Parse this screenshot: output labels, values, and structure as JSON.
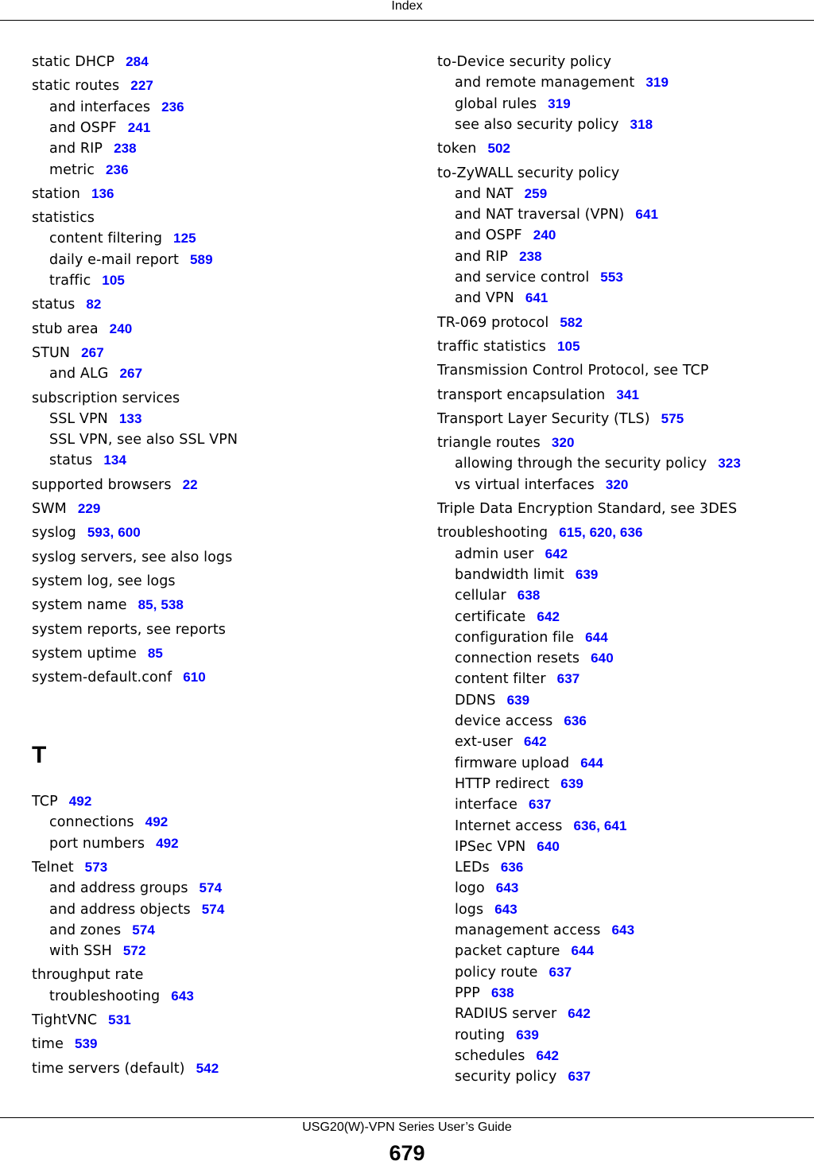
{
  "header": {
    "title": "Index"
  },
  "footer": {
    "guide_title": "USG20(W)-VPN Series User’s Guide",
    "page_number": "679"
  },
  "left_column": [
    {
      "term": "static DHCP",
      "pages": [
        "284"
      ],
      "level": 0
    },
    {
      "term": "static routes",
      "pages": [
        "227"
      ],
      "level": 0
    },
    {
      "term": "and interfaces",
      "pages": [
        "236"
      ],
      "level": 1
    },
    {
      "term": "and OSPF",
      "pages": [
        "241"
      ],
      "level": 1
    },
    {
      "term": "and RIP",
      "pages": [
        "238"
      ],
      "level": 1
    },
    {
      "term": "metric",
      "pages": [
        "236"
      ],
      "level": 1
    },
    {
      "term": "station",
      "pages": [
        "136"
      ],
      "level": 0
    },
    {
      "term": "statistics",
      "pages": [],
      "level": 0
    },
    {
      "term": "content filtering",
      "pages": [
        "125"
      ],
      "level": 1
    },
    {
      "term": "daily e-mail report",
      "pages": [
        "589"
      ],
      "level": 1
    },
    {
      "term": "traffic",
      "pages": [
        "105"
      ],
      "level": 1
    },
    {
      "term": "status",
      "pages": [
        "82"
      ],
      "level": 0
    },
    {
      "term": "stub area",
      "pages": [
        "240"
      ],
      "level": 0
    },
    {
      "term": "STUN",
      "pages": [
        "267"
      ],
      "level": 0
    },
    {
      "term": "and ALG",
      "pages": [
        "267"
      ],
      "level": 1
    },
    {
      "term": "subscription services",
      "pages": [],
      "level": 0
    },
    {
      "term": "SSL VPN",
      "pages": [
        "133"
      ],
      "level": 1
    },
    {
      "term": "SSL VPN, see also SSL VPN",
      "pages": [],
      "level": 1
    },
    {
      "term": "status",
      "pages": [
        "134"
      ],
      "level": 1
    },
    {
      "term": "supported browsers",
      "pages": [
        "22"
      ],
      "level": 0
    },
    {
      "term": "SWM",
      "pages": [
        "229"
      ],
      "level": 0
    },
    {
      "term": "syslog",
      "pages": [
        "593",
        "600"
      ],
      "level": 0
    },
    {
      "term": "syslog servers, see also logs",
      "pages": [],
      "level": 0
    },
    {
      "term": "system log, see logs",
      "pages": [],
      "level": 0
    },
    {
      "term": "system name",
      "pages": [
        "85",
        "538"
      ],
      "level": 0
    },
    {
      "term": "system reports, see reports",
      "pages": [],
      "level": 0
    },
    {
      "term": "system uptime",
      "pages": [
        "85"
      ],
      "level": 0
    },
    {
      "term": "system-default.conf",
      "pages": [
        "610"
      ],
      "level": 0
    }
  ],
  "section_letter": "T",
  "left_column_t": [
    {
      "term": "TCP",
      "pages": [
        "492"
      ],
      "level": 0
    },
    {
      "term": "connections",
      "pages": [
        "492"
      ],
      "level": 1
    },
    {
      "term": "port numbers",
      "pages": [
        "492"
      ],
      "level": 1
    },
    {
      "term": "Telnet",
      "pages": [
        "573"
      ],
      "level": 0
    },
    {
      "term": "and address groups",
      "pages": [
        "574"
      ],
      "level": 1
    },
    {
      "term": "and address objects",
      "pages": [
        "574"
      ],
      "level": 1
    },
    {
      "term": "and zones",
      "pages": [
        "574"
      ],
      "level": 1
    },
    {
      "term": "with SSH",
      "pages": [
        "572"
      ],
      "level": 1
    },
    {
      "term": "throughput rate",
      "pages": [],
      "level": 0
    },
    {
      "term": "troubleshooting",
      "pages": [
        "643"
      ],
      "level": 1
    },
    {
      "term": "TightVNC",
      "pages": [
        "531"
      ],
      "level": 0
    },
    {
      "term": "time",
      "pages": [
        "539"
      ],
      "level": 0
    },
    {
      "term": "time servers (default)",
      "pages": [
        "542"
      ],
      "level": 0
    }
  ],
  "right_column": [
    {
      "term": "to-Device security policy",
      "pages": [],
      "level": 0
    },
    {
      "term": "and remote management",
      "pages": [
        "319"
      ],
      "level": 1
    },
    {
      "term": "global rules",
      "pages": [
        "319"
      ],
      "level": 1
    },
    {
      "term": "see also security policy",
      "pages": [
        "318"
      ],
      "level": 1
    },
    {
      "term": "token",
      "pages": [
        "502"
      ],
      "level": 0
    },
    {
      "term": "to-ZyWALL security policy",
      "pages": [],
      "level": 0
    },
    {
      "term": "and NAT",
      "pages": [
        "259"
      ],
      "level": 1
    },
    {
      "term": "and NAT traversal (VPN)",
      "pages": [
        "641"
      ],
      "level": 1
    },
    {
      "term": "and OSPF",
      "pages": [
        "240"
      ],
      "level": 1
    },
    {
      "term": "and RIP",
      "pages": [
        "238"
      ],
      "level": 1
    },
    {
      "term": "and service control",
      "pages": [
        "553"
      ],
      "level": 1
    },
    {
      "term": "and VPN",
      "pages": [
        "641"
      ],
      "level": 1
    },
    {
      "term": "TR-069 protocol",
      "pages": [
        "582"
      ],
      "level": 0
    },
    {
      "term": "traffic statistics",
      "pages": [
        "105"
      ],
      "level": 0
    },
    {
      "term": "Transmission Control Protocol, see TCP",
      "pages": [],
      "level": 0
    },
    {
      "term": "transport encapsulation",
      "pages": [
        "341"
      ],
      "level": 0
    },
    {
      "term": "Transport Layer Security (TLS)",
      "pages": [
        "575"
      ],
      "level": 0
    },
    {
      "term": "triangle routes",
      "pages": [
        "320"
      ],
      "level": 0
    },
    {
      "term": "allowing through the security policy",
      "pages": [
        "323"
      ],
      "level": 1
    },
    {
      "term": "vs virtual interfaces",
      "pages": [
        "320"
      ],
      "level": 1
    },
    {
      "term": "Triple Data Encryption Standard, see 3DES",
      "pages": [],
      "level": 0
    },
    {
      "term": "troubleshooting",
      "pages": [
        "615",
        "620",
        "636"
      ],
      "level": 0
    },
    {
      "term": "admin user",
      "pages": [
        "642"
      ],
      "level": 1
    },
    {
      "term": "bandwidth limit",
      "pages": [
        "639"
      ],
      "level": 1
    },
    {
      "term": "cellular",
      "pages": [
        "638"
      ],
      "level": 1
    },
    {
      "term": "certificate",
      "pages": [
        "642"
      ],
      "level": 1
    },
    {
      "term": "configuration file",
      "pages": [
        "644"
      ],
      "level": 1
    },
    {
      "term": "connection resets",
      "pages": [
        "640"
      ],
      "level": 1
    },
    {
      "term": "content filter",
      "pages": [
        "637"
      ],
      "level": 1
    },
    {
      "term": "DDNS",
      "pages": [
        "639"
      ],
      "level": 1
    },
    {
      "term": "device access",
      "pages": [
        "636"
      ],
      "level": 1
    },
    {
      "term": "ext-user",
      "pages": [
        "642"
      ],
      "level": 1
    },
    {
      "term": "firmware upload",
      "pages": [
        "644"
      ],
      "level": 1
    },
    {
      "term": "HTTP redirect",
      "pages": [
        "639"
      ],
      "level": 1
    },
    {
      "term": "interface",
      "pages": [
        "637"
      ],
      "level": 1
    },
    {
      "term": "Internet access",
      "pages": [
        "636",
        "641"
      ],
      "level": 1
    },
    {
      "term": "IPSec VPN",
      "pages": [
        "640"
      ],
      "level": 1
    },
    {
      "term": "LEDs",
      "pages": [
        "636"
      ],
      "level": 1
    },
    {
      "term": "logo",
      "pages": [
        "643"
      ],
      "level": 1
    },
    {
      "term": "logs",
      "pages": [
        "643"
      ],
      "level": 1
    },
    {
      "term": "management access",
      "pages": [
        "643"
      ],
      "level": 1
    },
    {
      "term": "packet capture",
      "pages": [
        "644"
      ],
      "level": 1
    },
    {
      "term": "policy route",
      "pages": [
        "637"
      ],
      "level": 1
    },
    {
      "term": "PPP",
      "pages": [
        "638"
      ],
      "level": 1
    },
    {
      "term": "RADIUS server",
      "pages": [
        "642"
      ],
      "level": 1
    },
    {
      "term": "routing",
      "pages": [
        "639"
      ],
      "level": 1
    },
    {
      "term": "schedules",
      "pages": [
        "642"
      ],
      "level": 1
    },
    {
      "term": "security policy",
      "pages": [
        "637"
      ],
      "level": 1
    }
  ],
  "colors": {
    "page_link": "#0000ff",
    "text": "#000000"
  }
}
